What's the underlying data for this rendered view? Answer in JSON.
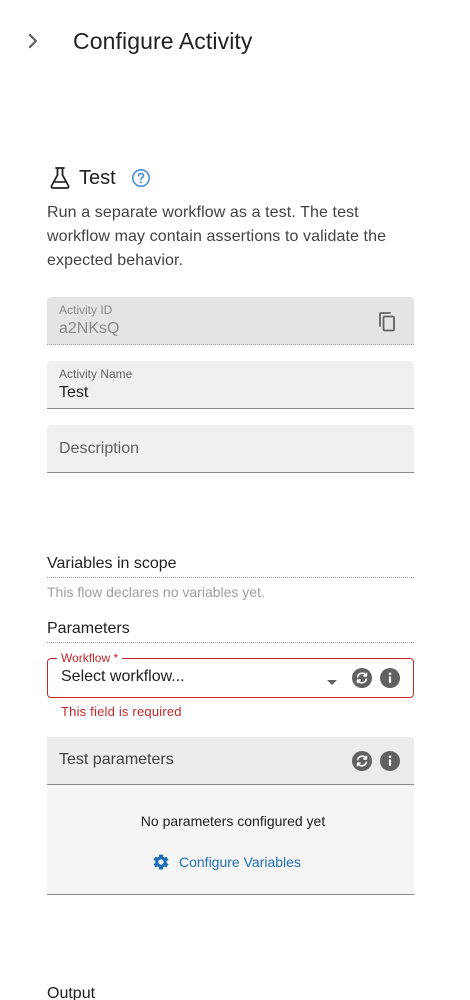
{
  "header": {
    "title": "Configure Activity"
  },
  "activity": {
    "title": "Test",
    "description": "Run a separate workflow as a test. The test workflow may contain assertions to validate the expected behavior."
  },
  "fields": {
    "activity_id": {
      "label": "Activity ID",
      "value": "a2NKsQ"
    },
    "activity_name": {
      "label": "Activity Name",
      "value": "Test"
    },
    "description": {
      "placeholder": "Description"
    }
  },
  "variables": {
    "heading": "Variables in scope",
    "empty_hint": "This flow declares no variables yet."
  },
  "parameters": {
    "heading": "Parameters",
    "workflow": {
      "label": "Workflow *",
      "value": "Select workflow...",
      "error": "This field is required"
    },
    "test_parameters": {
      "title": "Test parameters",
      "empty_message": "No parameters configured yet",
      "configure_label": "Configure Variables"
    }
  },
  "output": {
    "heading": "Output"
  },
  "colors": {
    "accent": "#1e6fb8",
    "error": "#c62828",
    "help_icon": "#4a90d9",
    "icon_gray": "#616161"
  }
}
